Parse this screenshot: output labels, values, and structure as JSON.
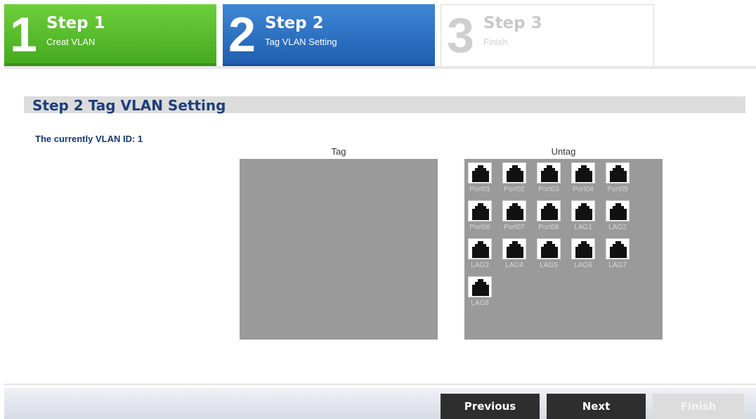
{
  "wizard": {
    "steps": [
      {
        "number": "1",
        "title": "Step 1",
        "subtitle": "Creat VLAN"
      },
      {
        "number": "2",
        "title": "Step 2",
        "subtitle": "Tag VLAN Setting"
      },
      {
        "number": "3",
        "title": "Step 3",
        "subtitle": "Finish"
      }
    ]
  },
  "section": {
    "title": "Step 2 Tag VLAN Setting",
    "vlan_id_label": "The currently VLAN ID: 1"
  },
  "panels": {
    "tag_title": "Tag",
    "untag_title": "Untag",
    "untag_ports": [
      "Port01",
      "Port02",
      "Port03",
      "Port04",
      "Port05",
      "Port06",
      "Port07",
      "Port08",
      "LAG1",
      "LAG2",
      "LAG3",
      "LAG4",
      "LAG5",
      "LAG6",
      "LAG7",
      "LAG8"
    ],
    "tag_ports": []
  },
  "footer": {
    "previous_label": "Previous",
    "next_label": "Next",
    "finish_label": "Finish"
  },
  "colors": {
    "step1": "#4fb527",
    "step2": "#2a6fc2",
    "section_title": "#1e3f7a",
    "panel_bg": "#9a9a9a"
  }
}
